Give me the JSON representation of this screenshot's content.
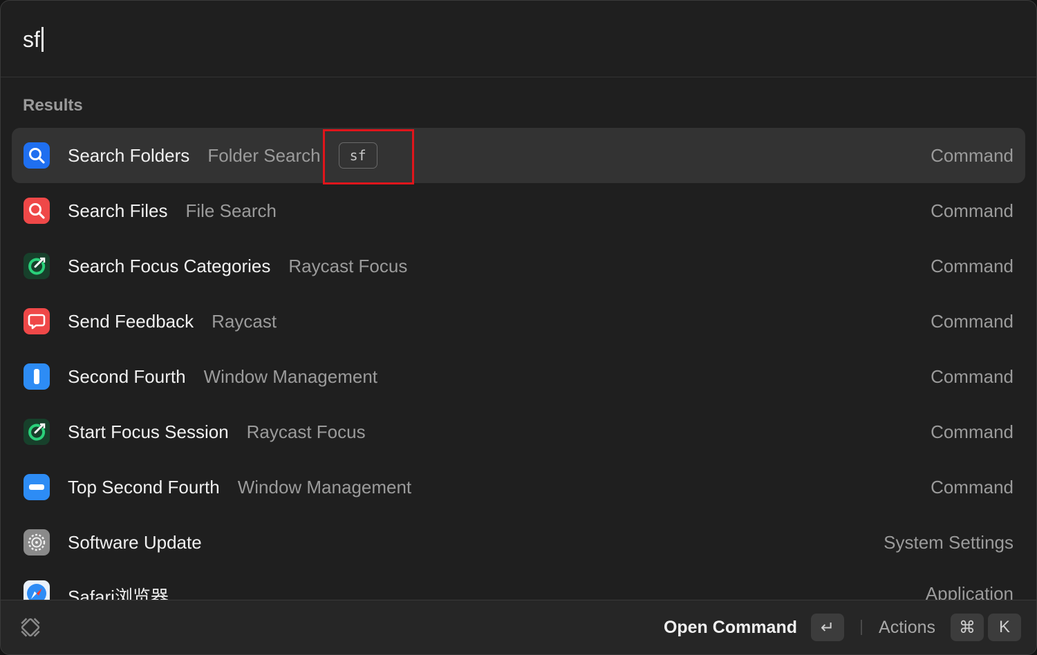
{
  "search": {
    "query": "sf"
  },
  "section_title": "Results",
  "results": [
    {
      "title": "Search Folders",
      "subtitle": "Folder Search",
      "alias": "sf",
      "accessory": "Command",
      "icon": "search-folders-icon",
      "icon_color": "#1f6ff0",
      "selected": true
    },
    {
      "title": "Search Files",
      "subtitle": "File Search",
      "accessory": "Command",
      "icon": "search-files-icon",
      "icon_color": "#ef4848"
    },
    {
      "title": "Search Focus Categories",
      "subtitle": "Raycast Focus",
      "accessory": "Command",
      "icon": "focus-icon",
      "icon_color": "#1f7a4c"
    },
    {
      "title": "Send Feedback",
      "subtitle": "Raycast",
      "accessory": "Command",
      "icon": "feedback-icon",
      "icon_color": "#ef4848"
    },
    {
      "title": "Second Fourth",
      "subtitle": "Window Management",
      "accessory": "Command",
      "icon": "window-second-fourth-icon",
      "icon_color": "#2d8cf5"
    },
    {
      "title": "Start Focus Session",
      "subtitle": "Raycast Focus",
      "accessory": "Command",
      "icon": "focus-icon",
      "icon_color": "#1f7a4c"
    },
    {
      "title": "Top Second Fourth",
      "subtitle": "Window Management",
      "accessory": "Command",
      "icon": "window-top-second-fourth-icon",
      "icon_color": "#2d8cf5"
    },
    {
      "title": "Software Update",
      "subtitle": "",
      "accessory": "System Settings",
      "icon": "gear-icon",
      "icon_color": "#8a8a8a"
    },
    {
      "title": "Safari浏览器",
      "subtitle": "",
      "accessory": "Application",
      "icon": "safari-icon",
      "icon_color": "#2d8cf5"
    }
  ],
  "footer": {
    "logo": "raycast-logo-icon",
    "primary_action": "Open Command",
    "primary_key": "↵",
    "actions_label": "Actions",
    "actions_keys": [
      "⌘",
      "K"
    ]
  }
}
